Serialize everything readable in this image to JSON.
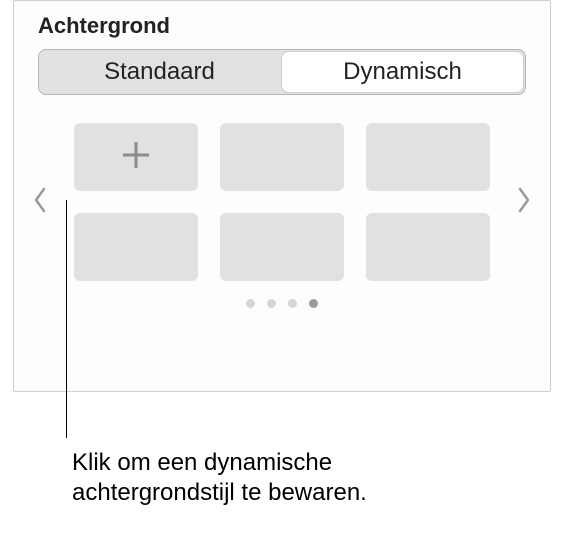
{
  "panel": {
    "title": "Achtergrond"
  },
  "tabs": {
    "standard": "Standaard",
    "dynamic": "Dynamisch",
    "active_index": 1
  },
  "grid": {
    "rows": 2,
    "cols": 3,
    "add_tile_index": 0
  },
  "pagination": {
    "count": 4,
    "active_index": 3
  },
  "icons": {
    "prev": "chevron-left",
    "next": "chevron-right",
    "add": "plus"
  },
  "callout": {
    "text": "Klik om een dynamische achtergrondstijl te bewaren."
  }
}
